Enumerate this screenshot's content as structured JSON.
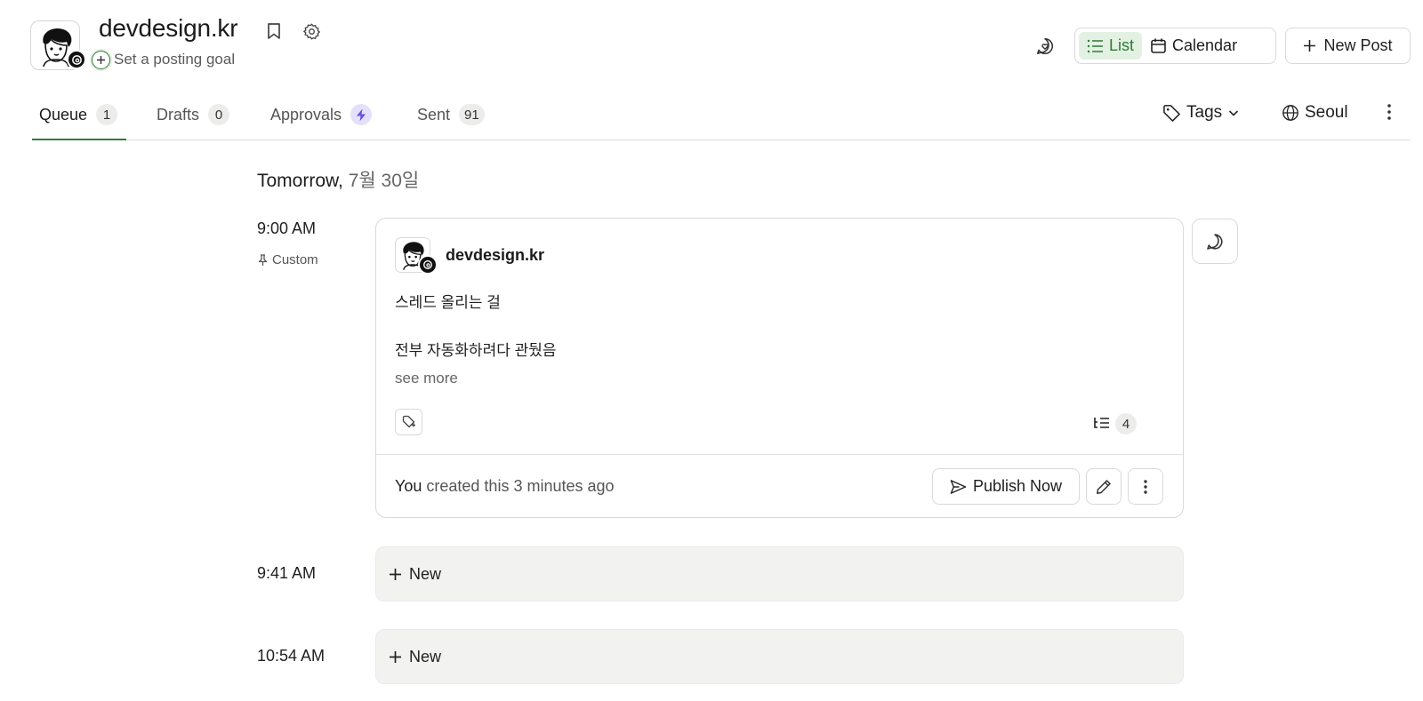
{
  "header": {
    "profile_name": "devdesign.kr",
    "goal_text": "Set a posting goal",
    "view_list_label": "List",
    "view_calendar_label": "Calendar",
    "new_post_label": "New Post"
  },
  "tabs": [
    {
      "label": "Queue",
      "count": "1"
    },
    {
      "label": "Drafts",
      "count": "0"
    },
    {
      "label": "Approvals",
      "count": ""
    },
    {
      "label": "Sent",
      "count": "91"
    }
  ],
  "filters": {
    "tags_label": "Tags",
    "timezone_label": "Seoul"
  },
  "day": {
    "heading_prefix": "Tomorrow,",
    "heading_date": "7월 30일"
  },
  "post": {
    "time": "9:00 AM",
    "slot_type": "Custom",
    "author": "devdesign.kr",
    "line1": "스레드 올리는 걸",
    "line2": "전부 자동화하려다 관뒀음",
    "see_more": "see more",
    "thread_count": "4",
    "created_actor": "You",
    "created_rest": "created this 3 minutes ago",
    "publish_label": "Publish Now"
  },
  "slots": [
    {
      "time": "9:41 AM",
      "label": "New"
    },
    {
      "time": "10:54 AM",
      "label": "New"
    }
  ],
  "colors": {
    "accent_green": "#2f7d3b",
    "active_view_bg": "#e3f1e3",
    "approvals_bolt": "#6b4ce6",
    "empty_slot_bg": "#f2f2f0"
  }
}
